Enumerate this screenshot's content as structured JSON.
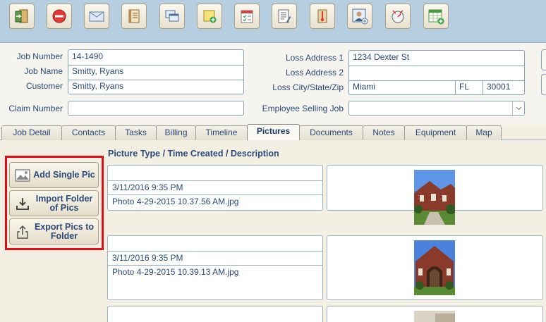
{
  "toolbar": {
    "buttons": [
      {
        "name": "exit-icon"
      },
      {
        "name": "delete-icon"
      },
      {
        "name": "email-icon"
      },
      {
        "name": "notebook-icon"
      },
      {
        "name": "windows-icon"
      },
      {
        "name": "add-note-icon"
      },
      {
        "name": "checklist-calendar-icon"
      },
      {
        "name": "report-icon"
      },
      {
        "name": "thermometer-icon"
      },
      {
        "name": "add-contact-icon"
      },
      {
        "name": "clock-tool-icon"
      },
      {
        "name": "add-calendar-icon"
      }
    ]
  },
  "form": {
    "job_number_label": "Job Number",
    "job_number": "14-1490",
    "job_name_label": "Job Name",
    "job_name": "Smitty, Ryans",
    "customer_label": "Customer",
    "customer": "Smitty, Ryans",
    "claim_number_label": "Claim Number",
    "claim_number": "",
    "loss_address1_label": "Loss Address 1",
    "loss_address1": "1234 Dexter St",
    "loss_address2_label": "Loss Address 2",
    "loss_address2": "",
    "loss_city_label": "Loss City/State/Zip",
    "loss_city": "Miami",
    "loss_state": "FL",
    "loss_zip": "30001",
    "employee_selling_label": "Employee Selling Job",
    "employee_selling": ""
  },
  "tabs": [
    {
      "label": "Job Detail"
    },
    {
      "label": "Contacts"
    },
    {
      "label": "Tasks"
    },
    {
      "label": "Billing"
    },
    {
      "label": "Timeline"
    },
    {
      "label": "Pictures"
    },
    {
      "label": "Documents"
    },
    {
      "label": "Notes"
    },
    {
      "label": "Equipment"
    },
    {
      "label": "Map"
    }
  ],
  "pictures": {
    "column_header": "Picture Type / Time Created / Description",
    "add_single_label": "Add Single Pic",
    "import_folder_label": "Import Folder of Pics",
    "export_pics_label": "Export Pics to Folder",
    "items": [
      {
        "type": "",
        "time": "3/11/2016 9:35 PM",
        "description": "Photo 4-29-2015 10.37.56 AM.jpg"
      },
      {
        "type": "",
        "time": "3/11/2016 9:35 PM",
        "description": "Photo 4-29-2015 10.39.13 AM.jpg"
      },
      {
        "type": "",
        "time": "",
        "description": ""
      }
    ]
  },
  "colors": {
    "toolbar_bg": "#b7cde0",
    "highlight": "#e10e1a",
    "text": "#2c4a78"
  }
}
